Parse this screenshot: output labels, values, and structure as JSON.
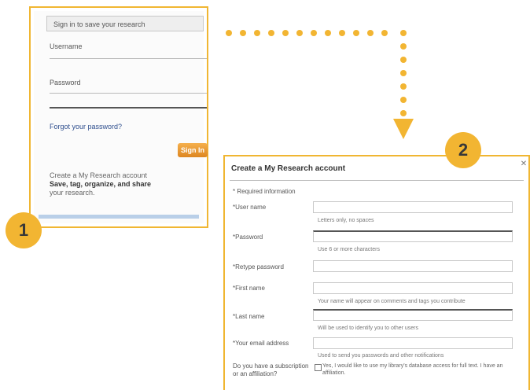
{
  "signin": {
    "header": "Sign in to save your research",
    "username_label": "Username",
    "password_label": "Password",
    "forgot_link": "Forgot your password?",
    "signin_button": "Sign In",
    "create_text": "Create a My Research account",
    "create_benefit": "Save, tag, organize, and share",
    "create_tail": "your research."
  },
  "create": {
    "title": "Create a My Research account",
    "subtitle": "* Required information",
    "fields": [
      {
        "label": "*User name",
        "hint": "Letters only, no spaces"
      },
      {
        "label": "*Password",
        "hint": "Use 6 or more characters"
      },
      {
        "label": "*Retype password",
        "hint": ""
      },
      {
        "label": "*First name",
        "hint": "Your name will appear on comments and tags you contribute"
      },
      {
        "label": "*Last name",
        "hint": "Will be used to identify you to other users"
      },
      {
        "label": "*Your email address",
        "hint": "Used to send you passwords and other notifications"
      }
    ],
    "checkbox_label": "Do you have a subscription or an affiliation?",
    "checkbox_text": "Yes, I would like to use my library's database access for full text. I have an affiliation."
  },
  "badges": {
    "one": "1",
    "two": "2"
  },
  "colors": {
    "accent": "#f2b532",
    "border": "#f0b632",
    "button": "#dd8620"
  }
}
